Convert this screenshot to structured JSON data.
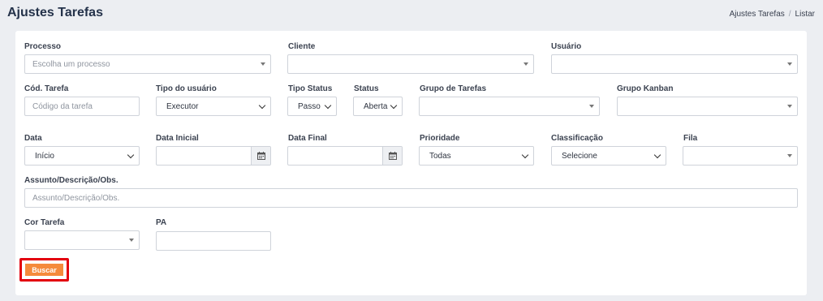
{
  "header": {
    "title": "Ajustes Tarefas",
    "breadcrumb": [
      "Ajustes Tarefas",
      "/",
      "Listar"
    ]
  },
  "form": {
    "processo": {
      "label": "Processo",
      "placeholder": "Escolha um processo"
    },
    "cliente": {
      "label": "Cliente",
      "value": ""
    },
    "usuario": {
      "label": "Usuário",
      "value": ""
    },
    "cod_tarefa": {
      "label": "Cód. Tarefa",
      "placeholder": "Código da tarefa"
    },
    "tipo_usuario": {
      "label": "Tipo do usuário",
      "value": "Executor"
    },
    "tipo_status": {
      "label": "Tipo Status",
      "value": "Passo"
    },
    "status": {
      "label": "Status",
      "value": "Aberta"
    },
    "grupo_tarefas": {
      "label": "Grupo de Tarefas",
      "value": ""
    },
    "grupo_kanban": {
      "label": "Grupo Kanban",
      "value": ""
    },
    "data": {
      "label": "Data",
      "value": "Início"
    },
    "data_inicial": {
      "label": "Data Inicial",
      "value": ""
    },
    "data_final": {
      "label": "Data Final",
      "value": ""
    },
    "prioridade": {
      "label": "Prioridade",
      "value": "Todas"
    },
    "classificacao": {
      "label": "Classificação",
      "value": "Selecione"
    },
    "fila": {
      "label": "Fila",
      "value": ""
    },
    "assunto": {
      "label": "Assunto/Descrição/Obs.",
      "placeholder": "Assunto/Descrição/Obs."
    },
    "cor_tarefa": {
      "label": "Cor Tarefa",
      "value": ""
    },
    "pa": {
      "label": "PA",
      "value": ""
    }
  },
  "actions": {
    "buscar": "Buscar"
  },
  "icons": {
    "select_arrow": "caret-down-icon",
    "select_chevron": "chevron-down-icon",
    "date": "calendar-icon"
  },
  "colors": {
    "accent": "#f58a3c",
    "highlight": "#e3000f",
    "background": "#eceef2"
  }
}
